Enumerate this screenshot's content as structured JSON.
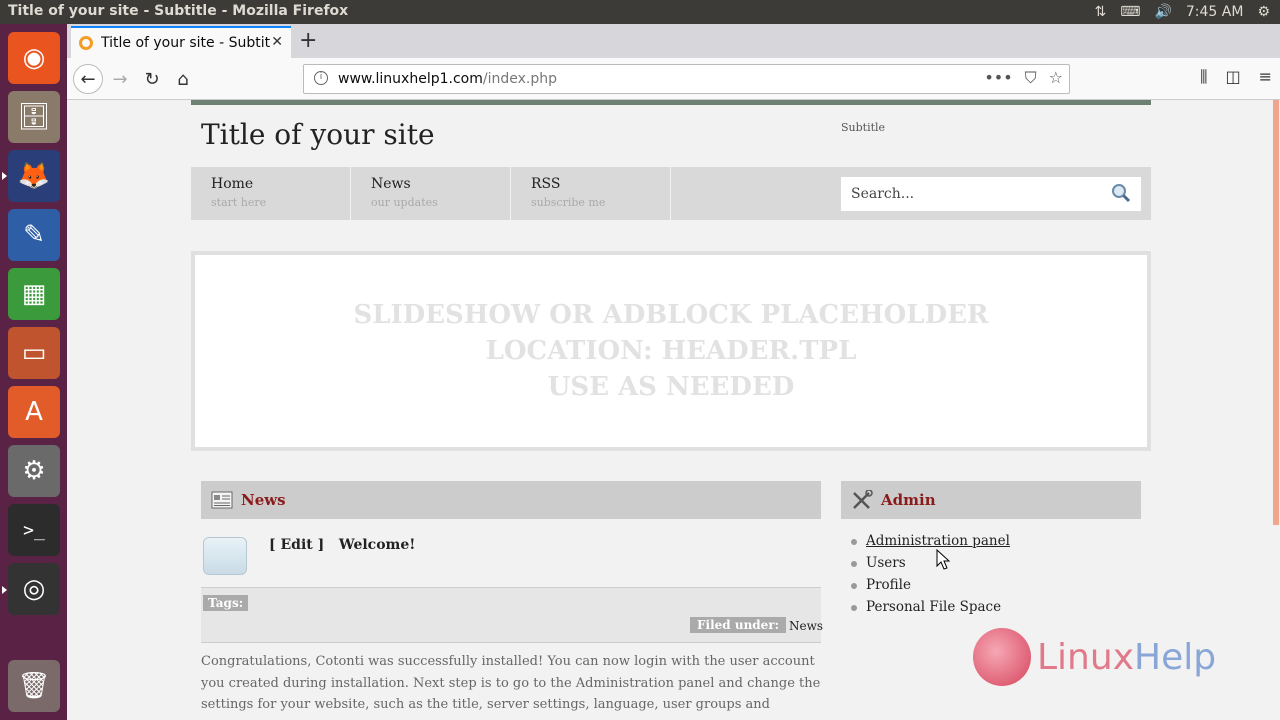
{
  "window": {
    "title": "Title of your site - Subtitle - Mozilla Firefox",
    "clock": "7:45 AM"
  },
  "tab": {
    "title": "Title of your site - Subtitle"
  },
  "url": {
    "host": "www.linuxhelp1.com",
    "path": "/index.php"
  },
  "site": {
    "title": "Title of your site",
    "subtitle": "Subtitle",
    "menu": [
      {
        "label": "Home",
        "sub": "start here"
      },
      {
        "label": "News",
        "sub": "our updates"
      },
      {
        "label": "RSS",
        "sub": "subscribe me"
      }
    ],
    "search_placeholder": "Search...",
    "slide": [
      "SLIDESHOW OR ADBLOCK PLACEHOLDER",
      "LOCATION: HEADER.TPL",
      "USE AS NEEDED"
    ]
  },
  "news": {
    "header": "News",
    "edit": "[ Edit ]",
    "item_title": "Welcome!",
    "tags_label": "Tags:",
    "filed_label": "Filed under:",
    "filed_value": "News",
    "body": "Congratulations, Cotonti was successfully installed! You can now login with the user account you created during installation. Next step is to go to the Administration panel and change the settings for your website, such as the title, server settings, language, user groups and extensions. You can"
  },
  "admin": {
    "header": "Admin",
    "items": [
      "Administration panel",
      "Users",
      "Profile",
      "Personal File Space"
    ]
  },
  "watermark": {
    "part1": "Linux",
    "part2": "Help"
  }
}
